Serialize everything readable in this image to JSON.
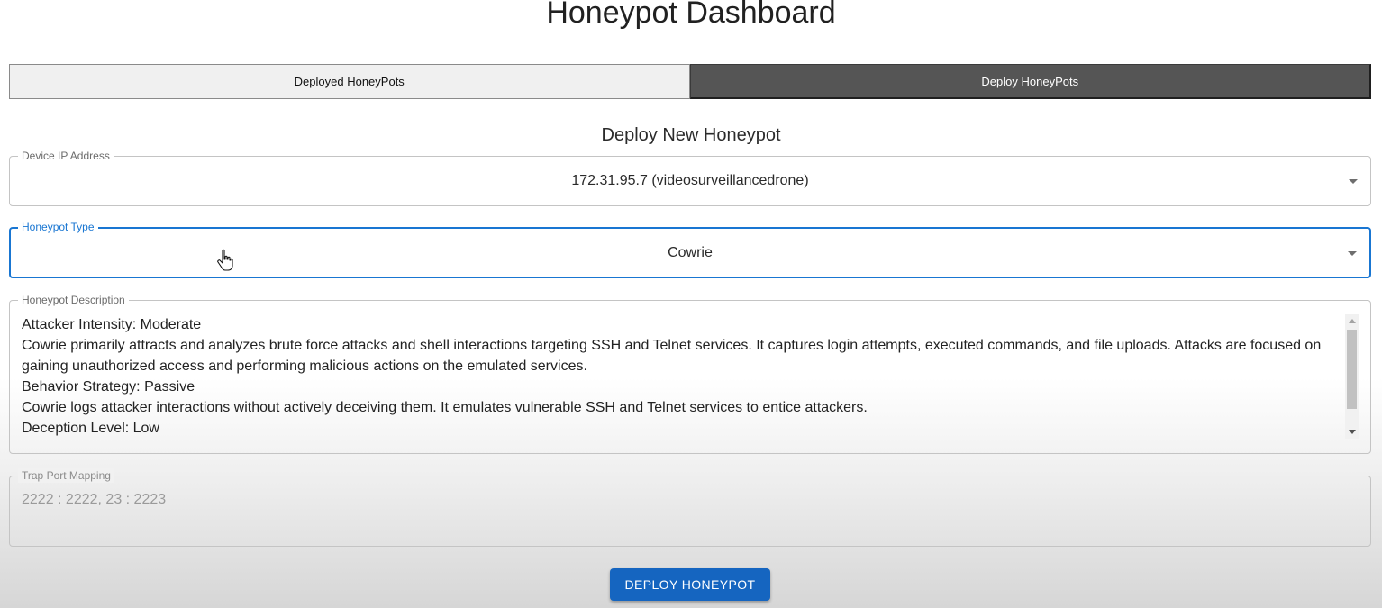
{
  "header": {
    "title": "Honeypot Dashboard"
  },
  "tabs": [
    {
      "label": "Deployed HoneyPots",
      "active": false
    },
    {
      "label": "Deploy HoneyPots",
      "active": true
    }
  ],
  "form": {
    "title": "Deploy New Honeypot",
    "ip": {
      "label": "Device IP Address",
      "value": "172.31.95.7 (videosurveillancedrone)"
    },
    "type": {
      "label": "Honeypot Type",
      "value": "Cowrie"
    },
    "description": {
      "label": "Honeypot Description",
      "lines": [
        "Attacker Intensity: Moderate",
        "Cowrie primarily attracts and analyzes brute force attacks and shell interactions targeting SSH and Telnet services. It captures login attempts, executed commands, and file uploads. Attacks are focused on gaining unauthorized access and performing malicious actions on the emulated services.",
        "Behavior Strategy: Passive",
        "Cowrie logs attacker interactions without actively deceiving them. It emulates vulnerable SSH and Telnet services to entice attackers.",
        "Deception Level: Low"
      ]
    },
    "ports": {
      "label": "Trap Port Mapping",
      "value": "2222 : 2222, 23 : 2223"
    },
    "submit_label": "DEPLOY HONEYPOT"
  },
  "colors": {
    "accent": "#1976d2",
    "button": "#1565c0",
    "active_tab": "#555555"
  },
  "icons": {
    "cursor": "hand-pointer-icon",
    "dropdown": "caret-down-icon"
  }
}
